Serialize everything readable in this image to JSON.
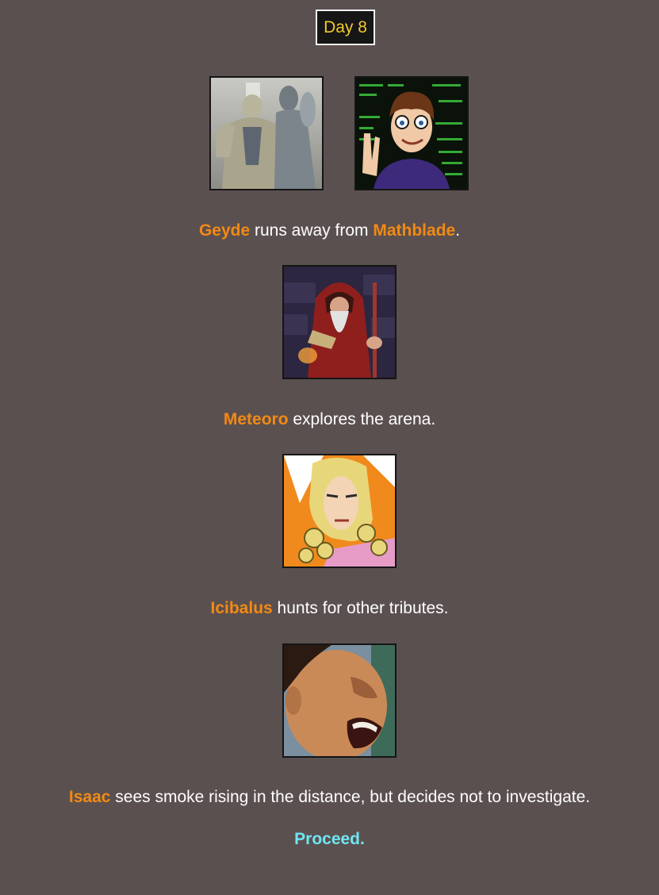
{
  "header": {
    "day_label": "Day 8"
  },
  "events": [
    {
      "tributes": [
        "Geyde",
        "Mathblade"
      ],
      "avatars": [
        "muscular-figures-avatar",
        "programmer-avatar"
      ],
      "segments": {
        "name1": "Geyde",
        "text1": " runs away from ",
        "name2": "Mathblade",
        "text2": "."
      }
    },
    {
      "tributes": [
        "Meteoro"
      ],
      "avatars": [
        "wizard-avatar"
      ],
      "segments": {
        "name1": "Meteoro",
        "text1": " explores the arena."
      }
    },
    {
      "tributes": [
        "Icibalus"
      ],
      "avatars": [
        "blonde-character-avatar"
      ],
      "segments": {
        "name1": "Icibalus",
        "text1": " hunts for other tributes."
      }
    },
    {
      "tributes": [
        "Isaac"
      ],
      "avatars": [
        "shouting-face-avatar"
      ],
      "segments": {
        "name1": "Isaac",
        "text1": " sees smoke rising in the distance, but decides not to investigate."
      }
    }
  ],
  "footer": {
    "proceed_label": "Proceed."
  },
  "colors": {
    "background": "#5b5050",
    "tribute_name": "#f28a13",
    "day_label": "#f3c82a",
    "proceed_link": "#6fe6f2"
  }
}
